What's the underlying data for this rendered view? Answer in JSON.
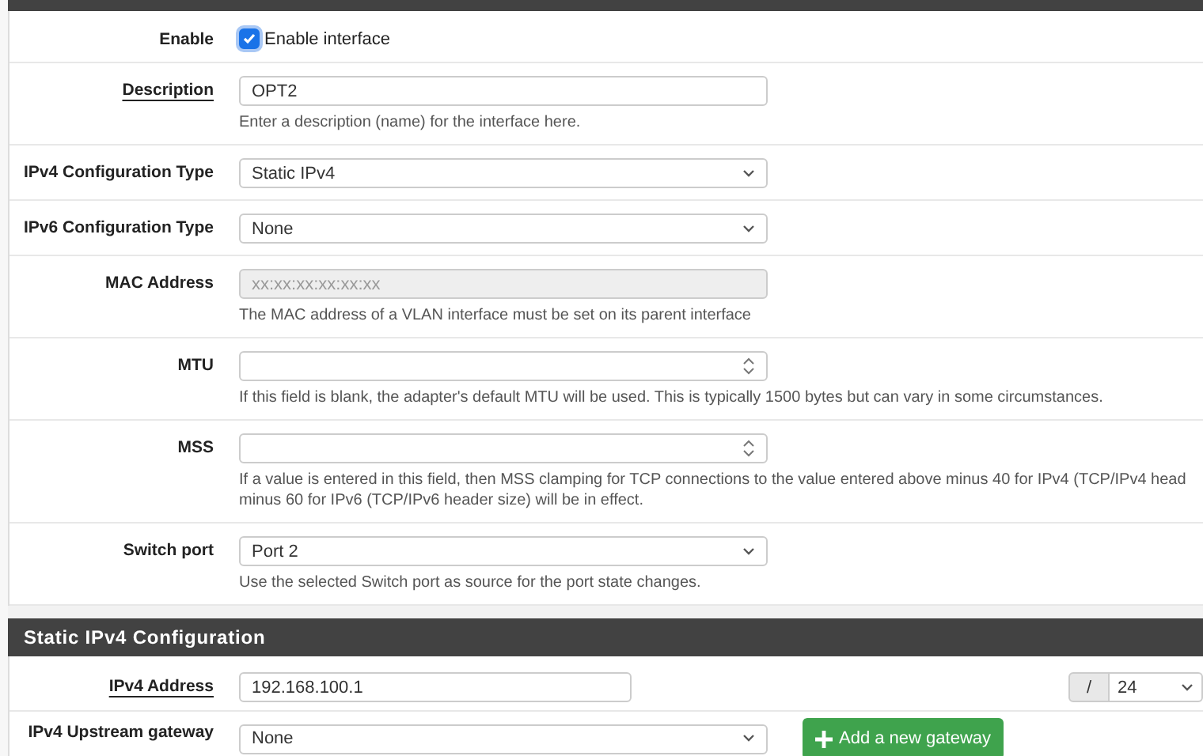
{
  "general": {
    "rows": [
      {
        "kind": "checkbox",
        "label": "Enable",
        "underlined": false,
        "checked": true,
        "text": "Enable interface"
      },
      {
        "kind": "text",
        "label": "Description",
        "underlined": true,
        "value": "OPT2",
        "help_lines": [
          "Enter a description (name) for the interface here."
        ]
      },
      {
        "kind": "select",
        "label": "IPv4 Configuration Type",
        "underlined": false,
        "value": "Static IPv4"
      },
      {
        "kind": "select",
        "label": "IPv6 Configuration Type",
        "underlined": false,
        "value": "None"
      },
      {
        "kind": "disabled",
        "label": "MAC Address",
        "underlined": false,
        "placeholder": "xx:xx:xx:xx:xx:xx",
        "help_lines": [
          "The MAC address of a VLAN interface must be set on its parent interface"
        ]
      },
      {
        "kind": "number",
        "label": "MTU",
        "underlined": false,
        "help_lines": [
          "If this field is blank, the adapter's default MTU will be used. This is typically 1500 bytes but can vary in some circumstances."
        ]
      },
      {
        "kind": "number",
        "label": "MSS",
        "underlined": false,
        "help_lines": [
          "If a value is entered in this field, then MSS clamping for TCP connections to the value entered above minus 40 for IPv4 (TCP/IPv4 head",
          "minus 60 for IPv6 (TCP/IPv6 header size) will be in effect."
        ]
      },
      {
        "kind": "select",
        "label": "Switch port",
        "underlined": false,
        "value": "Port 2",
        "help_lines": [
          "Use the selected Switch port as source for the port state changes."
        ]
      }
    ]
  },
  "static_ipv4": {
    "title": "Static IPv4 Configuration",
    "address": {
      "label": "IPv4 Address",
      "value": "192.168.100.1",
      "slash": "/",
      "mask": "24"
    },
    "gateway": {
      "label": "IPv4 Upstream gateway",
      "value": "None",
      "button": "Add a new gateway"
    }
  }
}
